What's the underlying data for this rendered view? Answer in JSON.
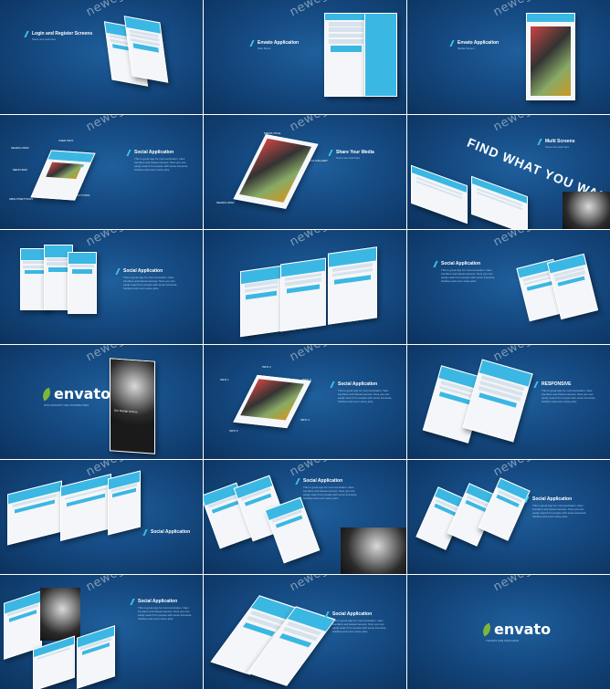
{
  "watermark": "newcger.com",
  "accent": "#3bb7e3",
  "background": "#154a82",
  "panels": [
    {
      "title": "Login and Register Screens",
      "subtitle": "Some text and here"
    },
    {
      "title": "Envato Application",
      "subtitle": "Side Menu"
    },
    {
      "title": "Envato Application",
      "subtitle": "Media Screen"
    },
    {
      "title": "Social Application",
      "description": "This is great App for communication. New interface and Awesomeness. Now you can easily search for people with same interests, hobbies and even same jobs.",
      "annotations": [
        "SEARCH BAR",
        "USER INFO",
        "LIKES/SHARE",
        "MENU BAR",
        "BUTTONS",
        "ABOUT/SETTINGS"
      ]
    },
    {
      "title": "Share Your Media",
      "subtitle": "Some text and here",
      "annotations": [
        "MEDIA TITLE",
        "MEDIA GALLERY",
        "SEARCH BAR"
      ]
    },
    {
      "title": "Multi Screens",
      "subtitle": "Some text and here",
      "banner": "FIND WHAT YOU WANT"
    },
    {
      "title": "Social Application",
      "description": "This is great App for communication. New interface and Awesomeness. Now you can easily search for people with same interests, hobbies and even same jobs."
    },
    {
      "title": "",
      "description": ""
    },
    {
      "title": "Social Application",
      "description": "This is great App for communication. New interface and Awesomeness. Now you can easily search for people with same interests, hobbies and even same jobs."
    },
    {
      "logo": "envato",
      "logo_sub": "WITH ENVATO THE POSSIBILITIES",
      "phone_caption": "Our Design Is Here"
    },
    {
      "title": "Social Application",
      "description": "This is great App for communication. New interface and Awesomeness. Now you can easily search for people with same interests, hobbies and even same jobs.",
      "annotations": [
        "INFO 1",
        "INFO 2",
        "INFO 3",
        "INFO 4",
        "INFO 5"
      ]
    },
    {
      "title": "RESPONSIVE",
      "description": "This is great App for communication. New interface and Awesomeness. Now you can easily search for people with same interests, hobbies and even same jobs."
    },
    {
      "title": "Social Application",
      "description": ""
    },
    {
      "title": "Social Application",
      "description": "This is great App for communication. New interface and Awesomeness. Now you can easily search for people with same interests, hobbies and even same jobs."
    },
    {
      "title": "Social Application",
      "description": "This is great App for communication. New interface and Awesomeness. Now you can easily search for people with same interests, hobbies and even same jobs."
    },
    {
      "title": "Social Application",
      "description": "This is great App for communication. New interface and Awesomeness. Now you can easily search for people with same interests, hobbies and even same jobs."
    },
    {
      "title": "Social Application",
      "description": "This is great App for communication. New interface and Awesomeness. Now you can easily search for people with same interests, hobbies and even same jobs."
    },
    {
      "logo": "envato",
      "logo_sub": "THANKS FOR WATCHING"
    }
  ]
}
